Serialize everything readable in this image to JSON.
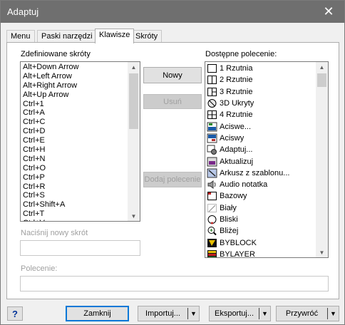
{
  "window": {
    "title": "Adaptuj",
    "close_glyph": "✕"
  },
  "tabs": [
    {
      "label": "Menu"
    },
    {
      "label": "Paski narzędzi"
    },
    {
      "label": "Klawisze"
    },
    {
      "label": "Skróty"
    }
  ],
  "active_tab": "Klawisze",
  "shortcuts": {
    "label": "Zdefiniowane skróty",
    "items": [
      "Alt+Down Arrow",
      "Alt+Left Arrow",
      "Alt+Right Arrow",
      "Alt+Up Arrow",
      "Ctrl+1",
      "Ctrl+A",
      "Ctrl+C",
      "Ctrl+D",
      "Ctrl+E",
      "Ctrl+H",
      "Ctrl+N",
      "Ctrl+O",
      "Ctrl+P",
      "Ctrl+R",
      "Ctrl+S",
      "Ctrl+Shift+A",
      "Ctrl+T",
      "Ctrl+V"
    ]
  },
  "middle_buttons": {
    "new": "Nowy",
    "delete": "Usuń",
    "add_command": "Dodaj polecenie"
  },
  "commands": {
    "label": "Dostępne polecenie:",
    "items": [
      {
        "label": "1 Rzutnia",
        "icon": "viewport-1-icon"
      },
      {
        "label": "2 Rzutnie",
        "icon": "viewport-2-icon"
      },
      {
        "label": "3 Rzutnie",
        "icon": "viewport-3-icon"
      },
      {
        "label": "3D Ukryty",
        "icon": "hide-3d-icon"
      },
      {
        "label": "4 Rzutnie",
        "icon": "viewport-4-icon"
      },
      {
        "label": "Aciswe...",
        "icon": "acis-export-icon"
      },
      {
        "label": "Aciswy",
        "icon": "acis-import-icon"
      },
      {
        "label": "Adaptuj...",
        "icon": "customize-icon"
      },
      {
        "label": "Aktualizuj",
        "icon": "update-icon"
      },
      {
        "label": "Arkusz z szablonu...",
        "icon": "sheet-template-icon"
      },
      {
        "label": "Audio notatka",
        "icon": "audio-note-icon"
      },
      {
        "label": "Bazowy",
        "icon": "base-icon"
      },
      {
        "label": "Biały",
        "icon": "white-icon"
      },
      {
        "label": "Bliski",
        "icon": "nearest-icon"
      },
      {
        "label": "Bliżej",
        "icon": "zoom-in-icon"
      },
      {
        "label": "BYBLOCK",
        "icon": "byblock-icon"
      },
      {
        "label": "BYLAYER",
        "icon": "bylayer-icon"
      }
    ]
  },
  "new_shortcut": {
    "label": "Naciśnij nowy skrót",
    "value": ""
  },
  "command_field": {
    "label": "Polecenie:",
    "value": ""
  },
  "footer": {
    "help": "?",
    "close": "Zamknij",
    "import": "Importuj...",
    "export": "Eksportuj...",
    "restore": "Przywróć",
    "arrow": "▼"
  },
  "colors": {
    "titlebar": "#6f6f6f",
    "primary_border": "#0078d7"
  }
}
